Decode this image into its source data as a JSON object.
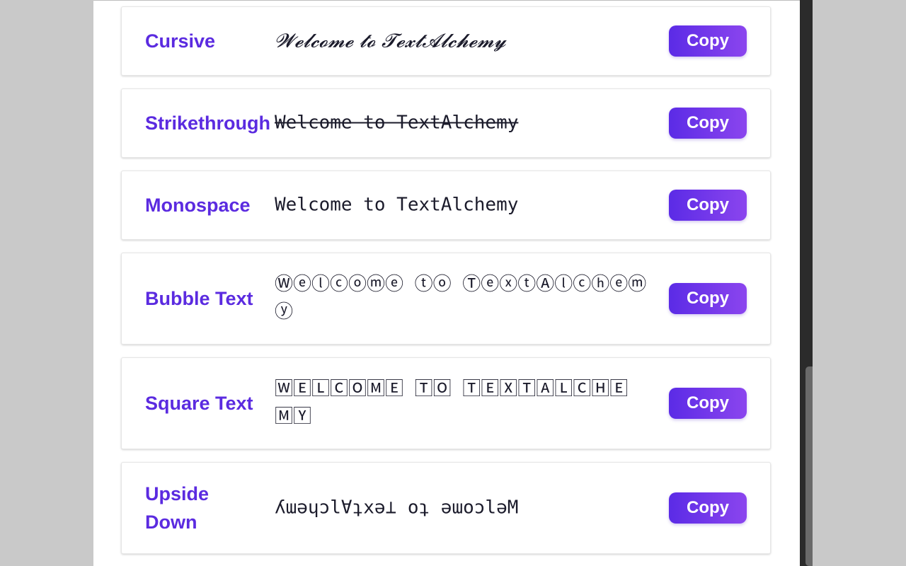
{
  "styles": [
    {
      "name": "Cursive",
      "sample": "𝓦𝓮𝓵𝓬𝓸𝓶𝓮 𝓽𝓸 𝓣𝓮𝔁𝓽𝓐𝓵𝓬𝓱𝓮𝓶𝔂",
      "copy_label": "Copy"
    },
    {
      "name": "Strikethrough",
      "sample": "Welcome to TextAlchemy",
      "copy_label": "Copy"
    },
    {
      "name": "Monospace",
      "sample": "Welcome to TextAlchemy",
      "copy_label": "Copy"
    },
    {
      "name": "Bubble Text",
      "sample": "Ⓦⓔⓛⓒⓞⓜⓔ ⓣⓞ ⓉⓔⓧⓣⒶⓛⓒⓗⓔⓜⓨ",
      "copy_label": "Copy"
    },
    {
      "name": "Square Text",
      "sample": "🅆🄴🄻🄲🄾🄼🄴 🅃🄾 🅃🄴🅇🅃🄰🄻🄲🄷🄴🄼🅈",
      "copy_label": "Copy"
    },
    {
      "name": "Upside Down",
      "sample": "ʎɯǝɥɔlⱯʇxǝ⊥ oʇ ǝɯoɔlǝM",
      "copy_label": "Copy"
    }
  ]
}
